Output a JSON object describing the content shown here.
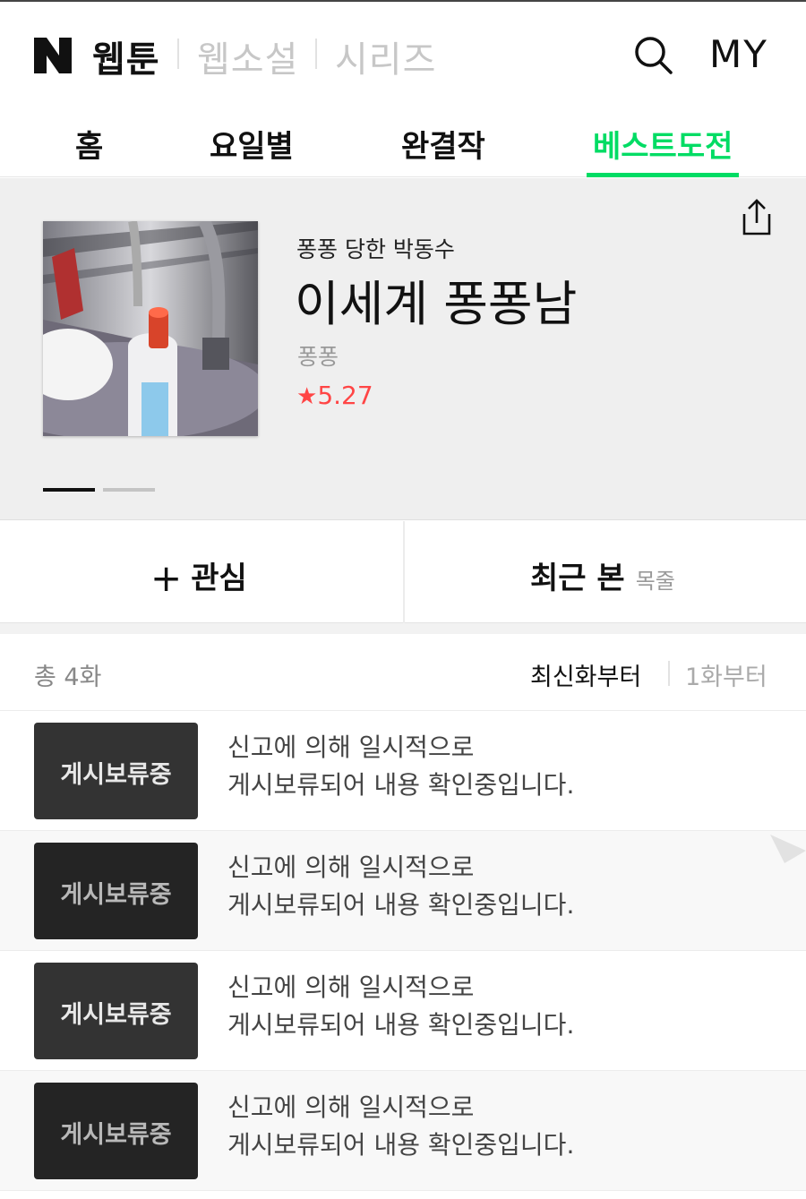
{
  "header": {
    "logo": "N",
    "services": [
      "웹툰",
      "웹소설",
      "시리즈"
    ],
    "active_service": "웹툰",
    "search_icon": "search-icon",
    "my_label": "MY"
  },
  "tabs": {
    "items": [
      {
        "label": "홈"
      },
      {
        "label": "요일별"
      },
      {
        "label": "완결작"
      },
      {
        "label": "베스트도전"
      }
    ],
    "active": "베스트도전",
    "active_color": "#00dc64"
  },
  "title_info": {
    "subtitle": "퐁퐁 당한 박동수",
    "title": "이세계 퐁퐁남",
    "author": "퐁퐁",
    "rating_star": "★",
    "rating": "5.27",
    "rating_color": "#ff4545",
    "share_icon": "share-icon",
    "carousel_pages": 2,
    "carousel_active": 1
  },
  "actions": {
    "favorite_plus": "+",
    "favorite_label": "관심",
    "recent_label": "최근 본",
    "toc_label": "목줄"
  },
  "list": {
    "total_label": "총 4화",
    "sort_latest": "최신화부터",
    "sort_first": "1화부터",
    "episodes": [
      {
        "badge": "게시보류중",
        "line1": "신고에 의해 일시적으로",
        "line2": "게시보류되어 내용 확인중입니다."
      },
      {
        "badge": "게시보류중",
        "line1": "신고에 의해 일시적으로",
        "line2": "게시보류되어 내용 확인중입니다."
      },
      {
        "badge": "게시보류중",
        "line1": "신고에 의해 일시적으로",
        "line2": "게시보류되어 내용 확인중입니다."
      },
      {
        "badge": "게시보류중",
        "line1": "신고에 의해 일시적으로",
        "line2": "게시보류되어 내용 확인중입니다."
      }
    ]
  }
}
